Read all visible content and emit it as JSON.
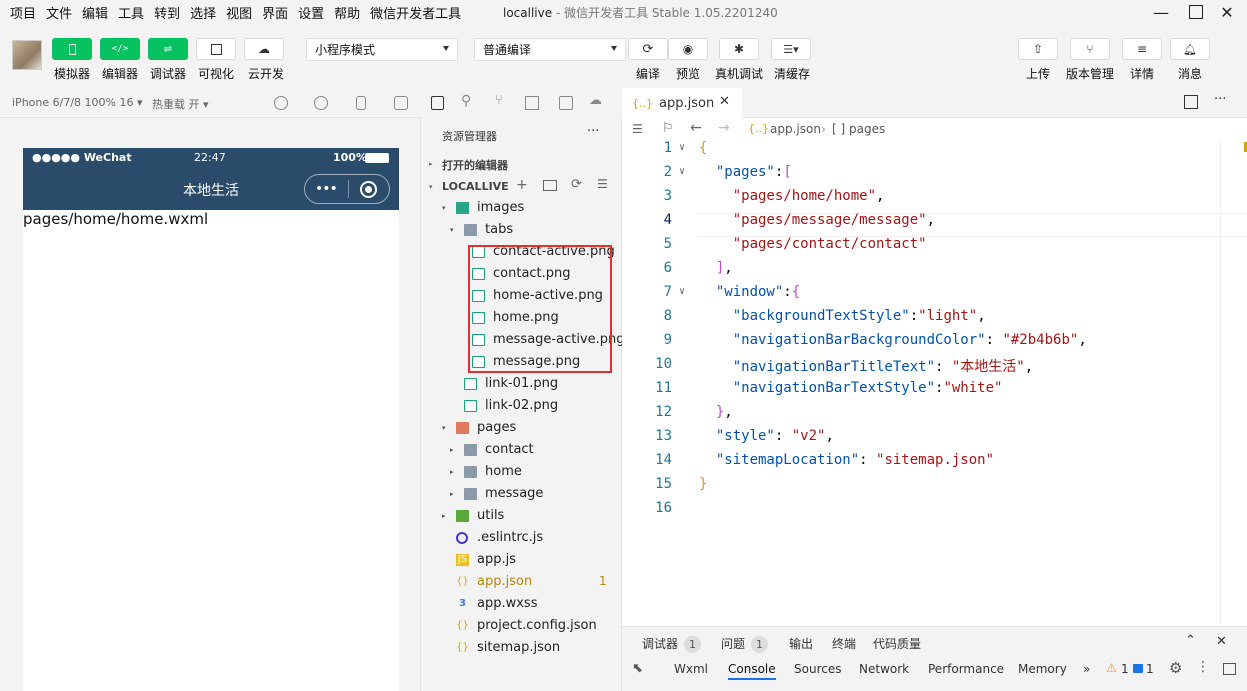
{
  "menu": [
    "项目",
    "文件",
    "编辑",
    "工具",
    "转到",
    "选择",
    "视图",
    "界面",
    "设置",
    "帮助",
    "微信开发者工具"
  ],
  "window": {
    "title": "locallive",
    "app": "微信开发者工具 Stable 1.05.2201240"
  },
  "toolbar": {
    "left_buttons": [
      "模拟器",
      "编辑器",
      "调试器",
      "可视化",
      "云开发"
    ],
    "mode_select": "小程序模式",
    "compile_select": "普通编译",
    "center_buttons": [
      "编译",
      "预览",
      "真机调试",
      "清缓存"
    ],
    "right_buttons": [
      "上传",
      "版本管理",
      "详情",
      "消息"
    ]
  },
  "simulator": {
    "device": "iPhone 6/7/8 100% 16 ▾",
    "hotreload": "热重载 开 ▾",
    "status_left": "●●●●● WeChat",
    "time": "22:47",
    "battery": "100%",
    "nav_title": "本地生活",
    "page_path": "pages/home/home.wxml"
  },
  "explorer": {
    "title": "资源管理器",
    "open_editors": "打开的编辑器",
    "project": "LOCALLIVE",
    "tree": [
      {
        "name": "images",
        "kind": "folder-img",
        "depth": 1,
        "twisty": "▾"
      },
      {
        "name": "tabs",
        "kind": "folder",
        "depth": 2,
        "twisty": "▾"
      },
      {
        "name": "contact-active.png",
        "kind": "png",
        "depth": 3
      },
      {
        "name": "contact.png",
        "kind": "png",
        "depth": 3
      },
      {
        "name": "home-active.png",
        "kind": "png",
        "depth": 3
      },
      {
        "name": "home.png",
        "kind": "png",
        "depth": 3
      },
      {
        "name": "message-active.png",
        "kind": "png",
        "depth": 3
      },
      {
        "name": "message.png",
        "kind": "png",
        "depth": 3
      },
      {
        "name": "link-01.png",
        "kind": "png",
        "depth": 2
      },
      {
        "name": "link-02.png",
        "kind": "png",
        "depth": 2
      },
      {
        "name": "pages",
        "kind": "folder-pages",
        "depth": 1,
        "twisty": "▾"
      },
      {
        "name": "contact",
        "kind": "folder",
        "depth": 2,
        "twisty": "▸"
      },
      {
        "name": "home",
        "kind": "folder",
        "depth": 2,
        "twisty": "▸"
      },
      {
        "name": "message",
        "kind": "folder",
        "depth": 2,
        "twisty": "▸"
      },
      {
        "name": "utils",
        "kind": "folder-utils",
        "depth": 1,
        "twisty": "▸"
      },
      {
        "name": ".eslintrc.js",
        "kind": "eslint",
        "depth": 1
      },
      {
        "name": "app.js",
        "kind": "js",
        "depth": 1
      },
      {
        "name": "app.json",
        "kind": "json",
        "depth": 1,
        "badge": "1",
        "modified": true
      },
      {
        "name": "app.wxss",
        "kind": "css",
        "depth": 1
      },
      {
        "name": "project.config.json",
        "kind": "json",
        "depth": 1
      },
      {
        "name": "sitemap.json",
        "kind": "json",
        "depth": 1
      }
    ]
  },
  "editor": {
    "tab": "app.json",
    "breadcrumb": [
      "app.json",
      "[ ] pages"
    ],
    "current_line": 4,
    "lines": [
      {
        "n": "1",
        "fold": "∨",
        "html": "<span class='b1'>{</span>"
      },
      {
        "n": "2",
        "fold": "∨",
        "html": "  <span class='k'>\"pages\"</span>:<span class='b2'>[</span>"
      },
      {
        "n": "3",
        "fold": "",
        "html": "    <span class='s'>\"pages/home/home\"</span>,"
      },
      {
        "n": "4",
        "fold": "",
        "html": "    <span class='s'>\"pages/message/message\"</span>,"
      },
      {
        "n": "5",
        "fold": "",
        "html": "    <span class='s'>\"pages/contact/contact\"</span>"
      },
      {
        "n": "6",
        "fold": "",
        "html": "  <span class='b2'>]</span>,"
      },
      {
        "n": "7",
        "fold": "∨",
        "html": "  <span class='k'>\"window\"</span>:<span class='b2'>{</span>"
      },
      {
        "n": "8",
        "fold": "",
        "html": "    <span class='k'>\"backgroundTextStyle\"</span>:<span class='s'>\"light\"</span>,"
      },
      {
        "n": "9",
        "fold": "",
        "html": "    <span class='k'>\"navigationBarBackgroundColor\"</span>: <span class='s'>\"#2b4b6b\"</span>,"
      },
      {
        "n": "10",
        "fold": "",
        "html": "    <span class='k'>\"navigationBarTitleText\"</span>: <span class='s'>\"本地生活\"</span>,"
      },
      {
        "n": "11",
        "fold": "",
        "html": "    <span class='k'>\"navigationBarTextStyle\"</span>:<span class='s'>\"white\"</span>"
      },
      {
        "n": "12",
        "fold": "",
        "html": "  <span class='b2'>}</span>,"
      },
      {
        "n": "13",
        "fold": "",
        "html": "  <span class='k'>\"style\"</span>: <span class='s'>\"v2\"</span>,"
      },
      {
        "n": "14",
        "fold": "",
        "html": "  <span class='k'>\"sitemapLocation\"</span>: <span class='s'>\"sitemap.json\"</span>"
      },
      {
        "n": "15",
        "fold": "",
        "html": "<span class='b1'>}</span>"
      },
      {
        "n": "16",
        "fold": "",
        "html": ""
      }
    ]
  },
  "panel": {
    "tabs": [
      {
        "label": "调试器",
        "count": "1"
      },
      {
        "label": "问题",
        "count": "1"
      },
      {
        "label": "输出"
      },
      {
        "label": "终端"
      },
      {
        "label": "代码质量"
      }
    ],
    "devtools_tabs": [
      "Wxml",
      "Console",
      "Sources",
      "Network",
      "Performance",
      "Memory",
      "»"
    ],
    "active_devtools_tab": "Console",
    "warn_count": "1",
    "info_count": "1"
  },
  "colors": {
    "nav_bg": "#2b4b6b",
    "accent_green": "#07c160",
    "highlight_red": "#e03131"
  }
}
